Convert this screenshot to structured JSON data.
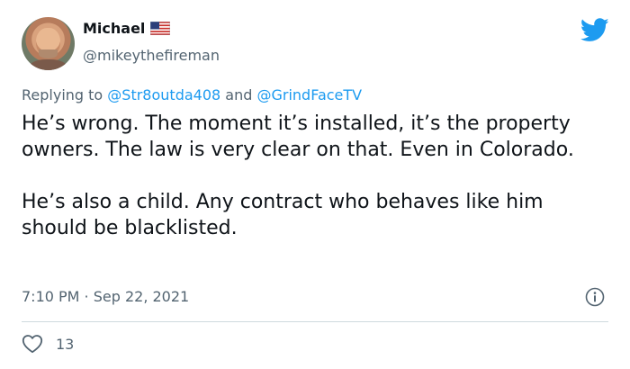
{
  "author": {
    "display_name": "Michael",
    "handle": "@mikeythefireman",
    "flag_icon": "us-flag-icon"
  },
  "reply": {
    "prefix": "Replying to",
    "mention1": "@Str8outda408",
    "conjunction": "and",
    "mention2": "@GrindFaceTV"
  },
  "tweet": {
    "paragraph1": "He’s wrong. The moment it’s installed, it’s the property owners. The law is very clear on that. Even in Colorado.",
    "paragraph2": "He’s also a child. Any contract who behaves like him should be blacklisted.",
    "timestamp": "7:10 PM · Sep 22, 2021"
  },
  "engagement": {
    "likes": "13"
  },
  "colors": {
    "twitter_blue": "#1d9bf0",
    "secondary_text": "#536471",
    "divider": "#cfd9de"
  }
}
